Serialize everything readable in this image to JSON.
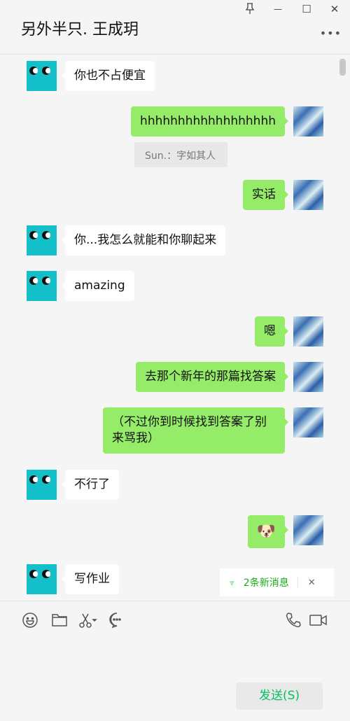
{
  "header": {
    "title": "另外半只. 王成玥",
    "pin": "pin-icon",
    "minimize": "—",
    "maximize": "☐",
    "close": "✕",
    "more": "•••"
  },
  "messages": [
    {
      "side": "them",
      "text": "你也不占便宜"
    },
    {
      "side": "me",
      "text": "hhhhhhhhhhhhhhhhhh"
    },
    {
      "side": "quote",
      "text": "Sun.：字如其人"
    },
    {
      "side": "me",
      "text": "实话"
    },
    {
      "side": "them",
      "text": "你...我怎么就能和你聊起来"
    },
    {
      "side": "them",
      "text": "amazing"
    },
    {
      "side": "me",
      "text": "嗯"
    },
    {
      "side": "me",
      "text": "去那个新年的那篇找答案"
    },
    {
      "side": "me",
      "text": "（不过你到时候找到答案了别来骂我）"
    },
    {
      "side": "them",
      "text": "不行了"
    },
    {
      "side": "me",
      "text": "🐶"
    },
    {
      "side": "them",
      "text": "写作业"
    }
  ],
  "new_messages": {
    "label": "2条新消息",
    "close": "✕"
  },
  "toolbar": {
    "icons": [
      "emoji-icon",
      "folder-icon",
      "scissors-icon",
      "chat-bubble-icon",
      "phone-icon",
      "video-icon"
    ]
  },
  "send_button": "发送(S)",
  "colors": {
    "my_bubble": "#95ec69",
    "their_bubble": "#ffffff",
    "accent": "#07c160"
  }
}
